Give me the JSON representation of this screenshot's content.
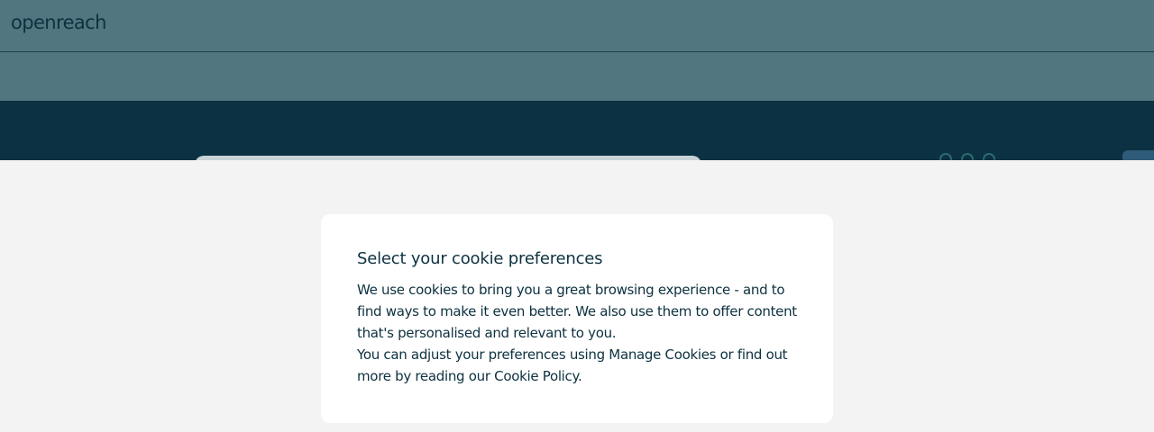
{
  "header": {
    "logo_text": "openreach"
  },
  "cookie_dialog": {
    "title": "Select your cookie preferences",
    "paragraph_1": "We use cookies to bring you a great browsing experience - and to find ways to make it even better. We also use them to offer content that's personalised and relevant to you.",
    "paragraph_2": "You can adjust your preferences using Manage Cookies or find out more by reading our Cookie Policy."
  },
  "colors": {
    "header_bg": "#52767f",
    "hero_bg": "#0b3142",
    "overlay_bg": "#f3f3f3",
    "dialog_bg": "#ffffff",
    "text": "#0d3140"
  }
}
